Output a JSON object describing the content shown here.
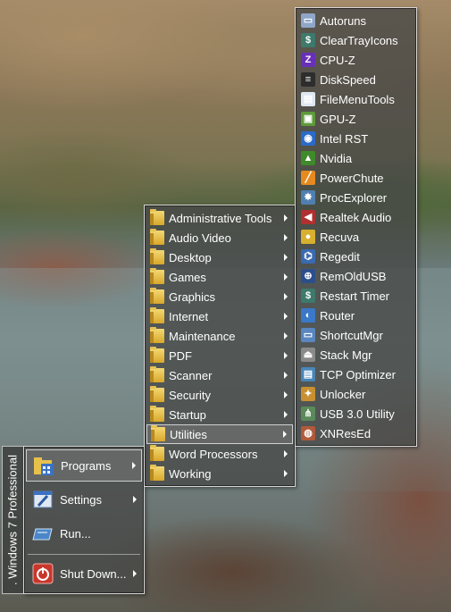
{
  "start_menu": {
    "sidebar_text": ". Windows 7 Professional",
    "items": [
      {
        "label": "Programs",
        "icon": "programs-icon"
      },
      {
        "label": "Settings",
        "icon": "settings-icon"
      },
      {
        "label": "Run...",
        "icon": "run-icon"
      },
      {
        "label": "Shut Down...",
        "icon": "power-icon"
      }
    ]
  },
  "programs_menu": {
    "items": [
      {
        "label": "Administrative Tools"
      },
      {
        "label": "Audio Video"
      },
      {
        "label": "Desktop"
      },
      {
        "label": "Games"
      },
      {
        "label": "Graphics"
      },
      {
        "label": "Internet"
      },
      {
        "label": "Maintenance"
      },
      {
        "label": "PDF"
      },
      {
        "label": "Scanner"
      },
      {
        "label": "Security"
      },
      {
        "label": "Startup"
      },
      {
        "label": "Utilities"
      },
      {
        "label": "Word Processors"
      },
      {
        "label": "Working"
      }
    ]
  },
  "utilities_menu": {
    "items": [
      {
        "label": "Autoruns",
        "icon": "autoruns-icon",
        "color": "#8fa6c8",
        "glyph": "▭"
      },
      {
        "label": "ClearTrayIcons",
        "icon": "cleartray-icon",
        "color": "#3e7a6c",
        "glyph": "$"
      },
      {
        "label": "CPU-Z",
        "icon": "cpuz-icon",
        "color": "#6a2fb8",
        "glyph": "Z"
      },
      {
        "label": "DiskSpeed",
        "icon": "diskspeed-icon",
        "color": "#2d2d2d",
        "glyph": "≡"
      },
      {
        "label": "FileMenuTools",
        "icon": "filemenutools-icon",
        "color": "#dfe7f2",
        "glyph": "▤"
      },
      {
        "label": "GPU-Z",
        "icon": "gpuz-icon",
        "color": "#5e9a3a",
        "glyph": "▣"
      },
      {
        "label": "Intel RST",
        "icon": "intel-rst-icon",
        "color": "#2a6ac8",
        "glyph": "◉"
      },
      {
        "label": "Nvidia",
        "icon": "nvidia-icon",
        "color": "#3f8a2a",
        "glyph": "▲"
      },
      {
        "label": "PowerChute",
        "icon": "powerchute-icon",
        "color": "#e58a1f",
        "glyph": "╱"
      },
      {
        "label": "ProcExplorer",
        "icon": "procexplorer-icon",
        "color": "#4f7fb0",
        "glyph": "✸"
      },
      {
        "label": "Realtek Audio",
        "icon": "speaker-icon",
        "color": "#b03030",
        "glyph": "◀"
      },
      {
        "label": "Recuva",
        "icon": "recuva-icon",
        "color": "#d8b030",
        "glyph": "●"
      },
      {
        "label": "Regedit",
        "icon": "regedit-icon",
        "color": "#3a6ab0",
        "glyph": "⌬"
      },
      {
        "label": "RemOldUSB",
        "icon": "remoldusb-icon",
        "color": "#2c4f8c",
        "glyph": "⊕"
      },
      {
        "label": "Restart Timer",
        "icon": "restart-timer-icon",
        "color": "#3e7a6c",
        "glyph": "$"
      },
      {
        "label": "Router",
        "icon": "router-icon",
        "color": "#3a78c8",
        "glyph": "◐"
      },
      {
        "label": "ShortcutMgr",
        "icon": "shortcutmgr-icon",
        "color": "#5a86c0",
        "glyph": "▭"
      },
      {
        "label": "Stack Mgr",
        "icon": "stack-icon",
        "color": "#8a8a8a",
        "glyph": "⏏"
      },
      {
        "label": "TCP Optimizer",
        "icon": "tcp-optimizer-icon",
        "color": "#4a86b8",
        "glyph": "▤"
      },
      {
        "label": "Unlocker",
        "icon": "unlocker-icon",
        "color": "#c89030",
        "glyph": "✦"
      },
      {
        "label": "USB 3.0 Utility",
        "icon": "usb-icon",
        "color": "#5a8a5a",
        "glyph": "⋔"
      },
      {
        "label": "XNResEd",
        "icon": "xnresed-icon",
        "color": "#b05a3a",
        "glyph": "◍"
      }
    ]
  }
}
